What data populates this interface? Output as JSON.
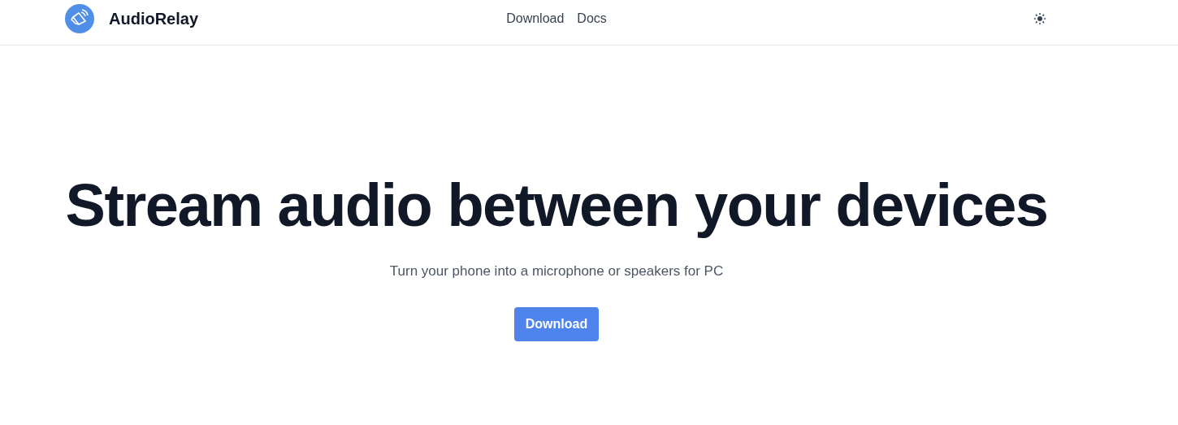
{
  "header": {
    "brand": "AudioRelay",
    "nav": [
      "Download",
      "Docs"
    ]
  },
  "hero": {
    "title": "Stream audio between your devices",
    "subtitle": "Turn your phone into a microphone or speakers for PC",
    "button": "Download"
  }
}
